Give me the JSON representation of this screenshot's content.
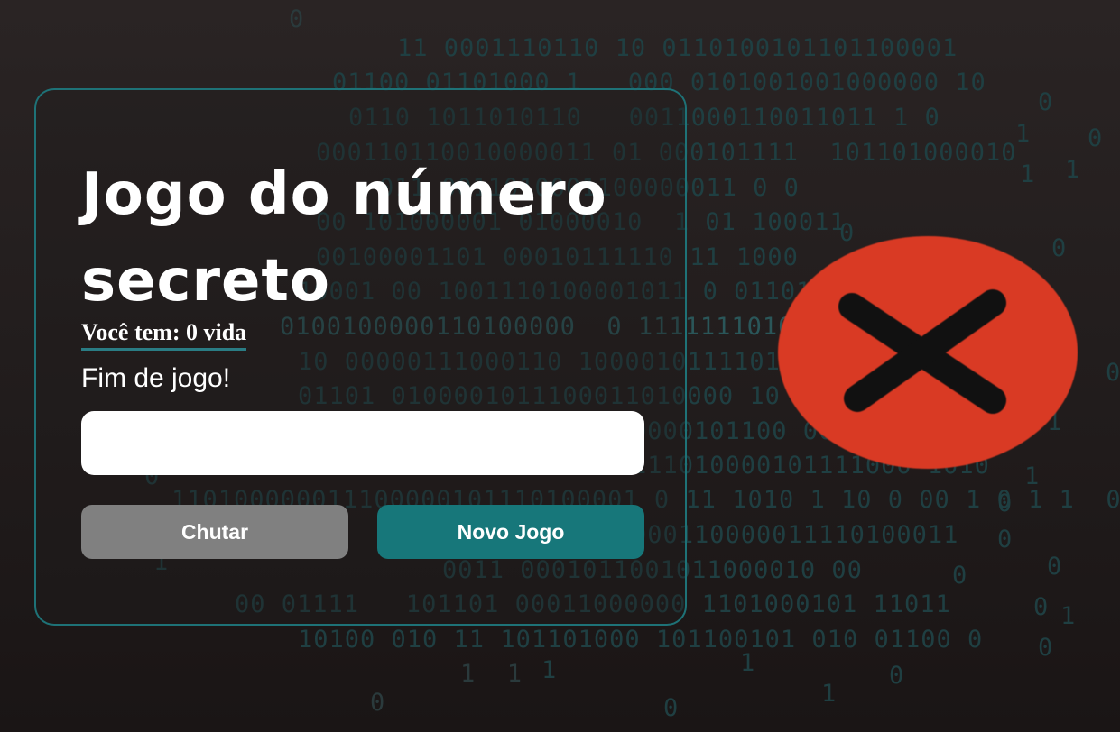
{
  "game": {
    "title": "Jogo do número secreto",
    "lives_text": "Você tem: 0 vida",
    "message": "Fim de jogo!",
    "guess_input": {
      "value": "",
      "placeholder": ""
    },
    "buttons": {
      "guess_label": "Chutar",
      "new_game_label": "Novo Jogo"
    }
  },
  "status_icon": {
    "name": "error-x-icon",
    "color": "#d93a24",
    "mark_color": "#111111"
  },
  "colors": {
    "accent": "#17777a",
    "border": "#1e7277",
    "disabled_button": "#808080",
    "background": "#231e1e"
  }
}
